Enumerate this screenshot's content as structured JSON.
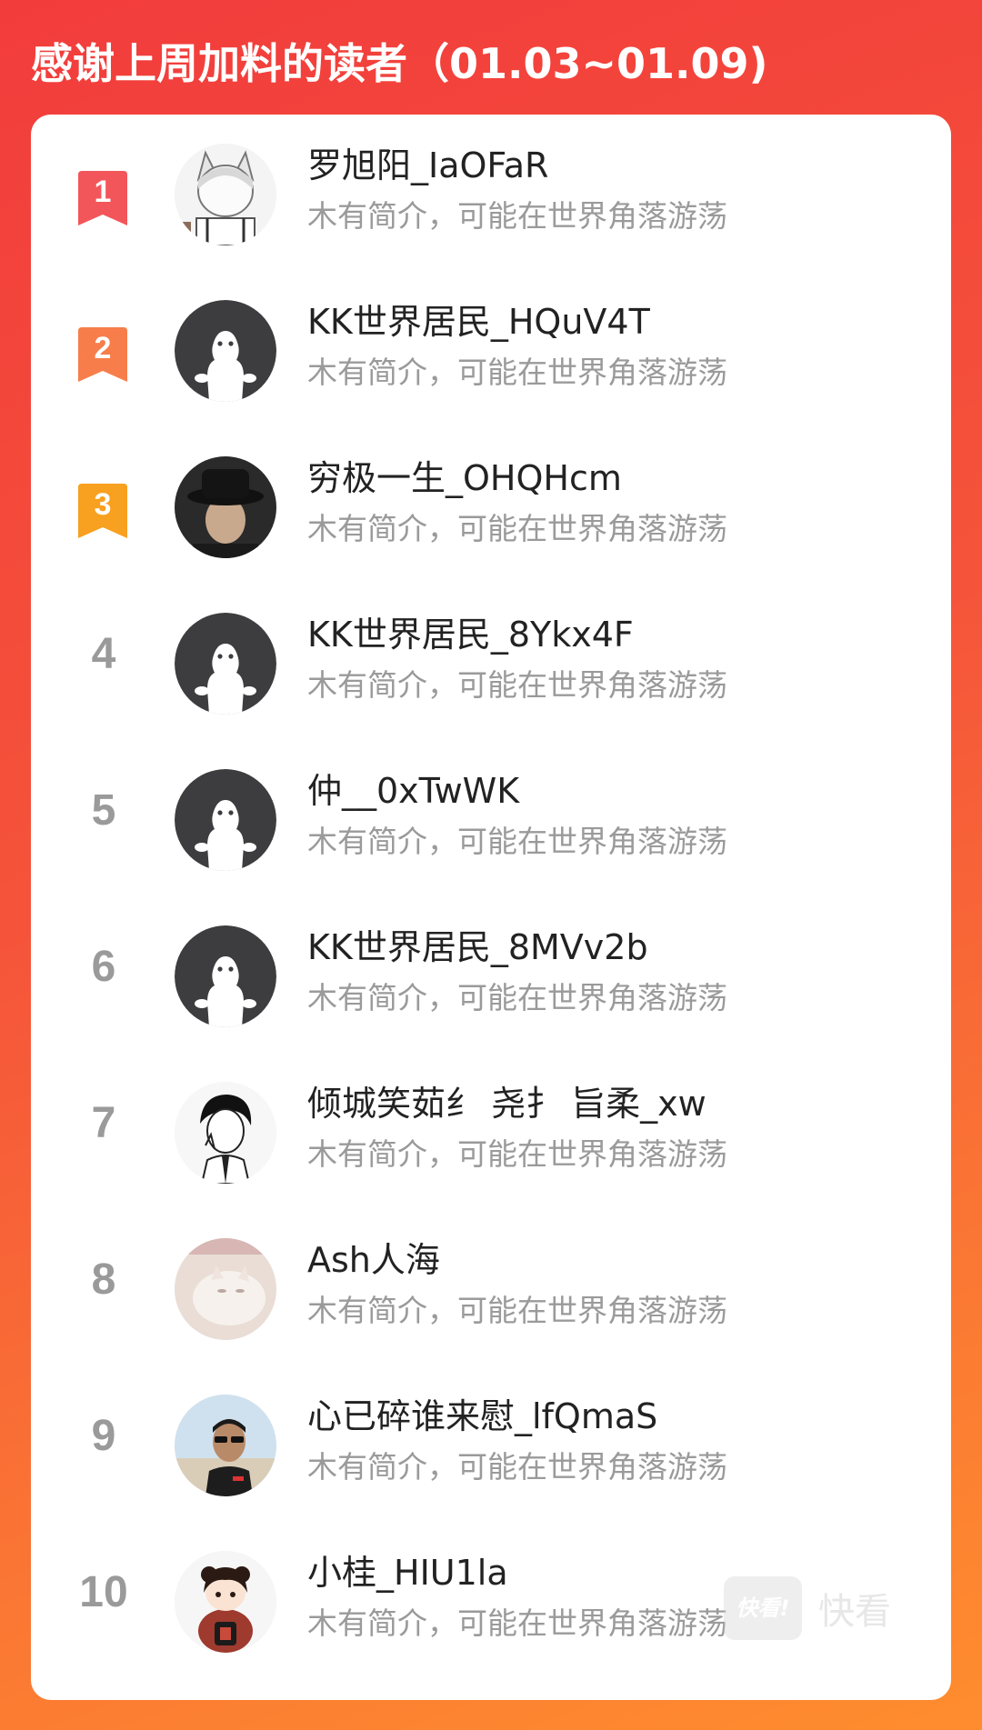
{
  "header": {
    "title": "感谢上周加料的读者（01.03~01.09)"
  },
  "colors": {
    "rank1": "#f3565a",
    "rank2": "#f77e4b",
    "rank3": "#f8a01f",
    "rank_gray": "#9a9a9a"
  },
  "readers": [
    {
      "rank": "1",
      "name": "罗旭阳_IaOFaR",
      "bio": "木有简介，可能在世界角落游荡",
      "avatar": "anime-boy-avatar"
    },
    {
      "rank": "2",
      "name": "KK世界居民_HQuV4T",
      "bio": "木有简介，可能在世界角落游荡",
      "avatar": "default-ghost-avatar"
    },
    {
      "rank": "3",
      "name": "穷极一生_OHQHcm",
      "bio": "木有简介，可能在世界角落游荡",
      "avatar": "hat-man-avatar"
    },
    {
      "rank": "4",
      "name": "KK世界居民_8Ykx4F",
      "bio": "木有简介，可能在世界角落游荡",
      "avatar": "default-ghost-avatar"
    },
    {
      "rank": "5",
      "name": "仲__0xTwWK",
      "bio": "木有简介，可能在世界角落游荡",
      "avatar": "default-ghost-avatar"
    },
    {
      "rank": "6",
      "name": "KK世界居民_8MVv2b",
      "bio": "木有简介，可能在世界角落游荡",
      "avatar": "default-ghost-avatar"
    },
    {
      "rank": "7",
      "name": "倾城笑茹纟 尧扌 旨柔_xw",
      "bio": "木有简介，可能在世界角落游荡",
      "avatar": "sketch-boy-avatar"
    },
    {
      "rank": "8",
      "name": "Ash人海",
      "bio": "木有简介，可能在世界角落游荡",
      "avatar": "cat-avatar"
    },
    {
      "rank": "9",
      "name": "心已碎谁来慰_lfQmaS",
      "bio": "木有简介，可能在世界角落游荡",
      "avatar": "sunglasses-man-avatar"
    },
    {
      "rank": "10",
      "name": "小桂_HIU1la",
      "bio": "木有简介，可能在世界角落游荡",
      "avatar": "cartoon-girl-avatar"
    }
  ],
  "watermark": {
    "logo": "快看!",
    "text": "快看"
  }
}
